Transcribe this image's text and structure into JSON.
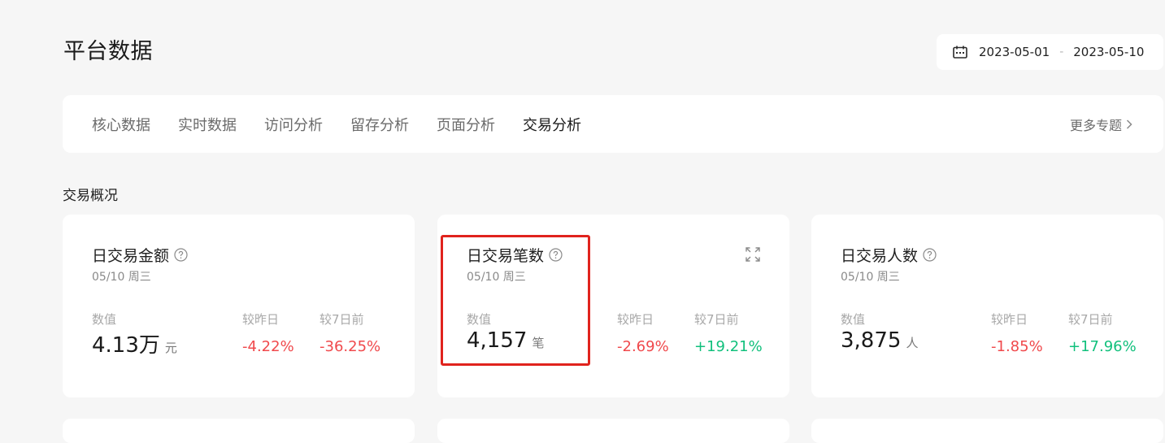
{
  "header": {
    "title": "平台数据",
    "date_range": {
      "start": "2023-05-01",
      "separator": "-",
      "end": "2023-05-10",
      "icon": "calendar-icon"
    }
  },
  "tabs": {
    "items": [
      {
        "label": "核心数据",
        "active": false
      },
      {
        "label": "实时数据",
        "active": false
      },
      {
        "label": "访问分析",
        "active": false
      },
      {
        "label": "留存分析",
        "active": false
      },
      {
        "label": "页面分析",
        "active": false
      },
      {
        "label": "交易分析",
        "active": true
      }
    ],
    "more_label": "更多专题",
    "more_icon": "chevron-right-icon"
  },
  "section": {
    "title": "交易概况"
  },
  "cards": [
    {
      "title": "日交易金额",
      "help_icon": "question-circle-icon",
      "date": "05/10 周三",
      "value_label": "数值",
      "value": "4.13万",
      "unit": "元",
      "yesterday_label": "较昨日",
      "yesterday_change": "-4.22%",
      "week_label": "较7日前",
      "week_change": "-36.25%"
    },
    {
      "title": "日交易笔数",
      "help_icon": "question-circle-icon",
      "expand_icon": "expand-icon",
      "date": "05/10 周三",
      "value_label": "数值",
      "value": "4,157",
      "unit": "笔",
      "yesterday_label": "较昨日",
      "yesterday_change": "-2.69%",
      "week_label": "较7日前",
      "week_change": "+19.21%"
    },
    {
      "title": "日交易人数",
      "help_icon": "question-circle-icon",
      "date": "05/10 周三",
      "value_label": "数值",
      "value": "3,875",
      "unit": "人",
      "yesterday_label": "较昨日",
      "yesterday_change": "-1.85%",
      "week_label": "较7日前",
      "week_change": "+17.96%"
    }
  ],
  "colors": {
    "negative": "#f0494c",
    "positive": "#11c07c",
    "highlight": "#e0231d"
  }
}
